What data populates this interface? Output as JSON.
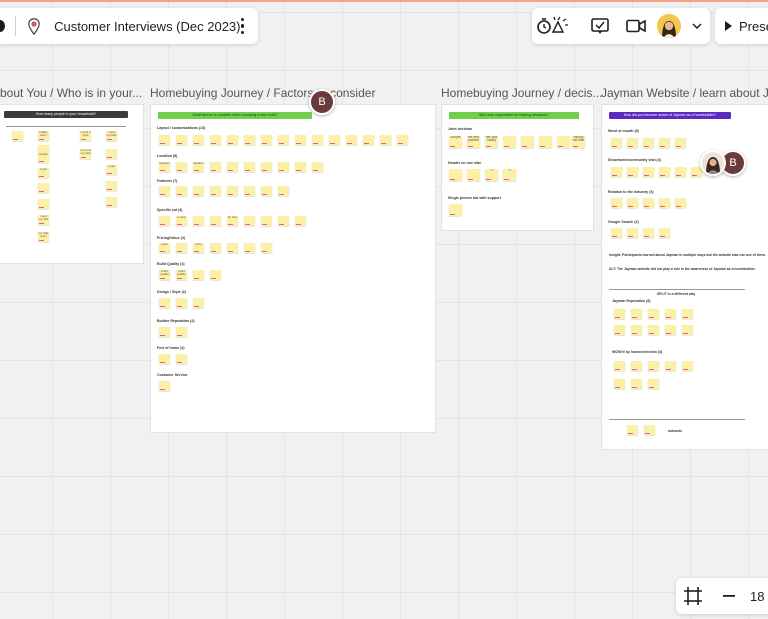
{
  "board": {
    "title": "Customer Interviews (Dec 2023)"
  },
  "toolbar": {
    "present_label": "Prese",
    "zoom_value": "18"
  },
  "users": {
    "marker_initial": "B"
  },
  "frames": [
    {
      "title": "bout You / Who is in your...",
      "banner": "How many people in your household?",
      "notes": [
        "hubby and i",
        "couple",
        "2 ppl",
        "i and my wife",
        "my wife and i",
        "i and my kids",
        "3 and 2 hppl",
        "me and my wife",
        "4 ppl"
      ]
    },
    {
      "title": "Homebuying Journey / Factors to consider",
      "banner": "What factors to consider when choosing a new build?",
      "categories": [
        "Layout / customizations (13)",
        "Location (8)",
        "Features (7)",
        "Specific cat (4)",
        "Pricing/Value (4)",
        "Build Quality (4)",
        "Design / Style (2)",
        "Builder Reputation (2)",
        "Feel of home (4)",
        "Customer Service"
      ],
      "notes": [
        "location",
        "location",
        "price",
        "price",
        "lot size",
        "a view",
        "build quality",
        "build quality"
      ]
    },
    {
      "title": "Homebuying Journey / decis...",
      "banner": "Who was responsible for making decisions?",
      "categories": [
        "Joint decision",
        "Header on one side",
        "Single person but with support"
      ],
      "notes": [
        "couple",
        "me and partner",
        "her and hubby",
        "mostly me wife",
        "??",
        "??"
      ]
    },
    {
      "title": "Jayman Website / learn about Ja...",
      "banner": "How did you become aware of Jayman as a homebuilder?",
      "categories": [
        "Word of mouth (5)",
        "Showhome/community visit (4)",
        "Relation to the industry (3)",
        "Google Search (2)",
        "Jayman Reputation (8)",
        "WOW'd by home/selection (3)"
      ],
      "insight_1": "Insight: Participants learned about Jayman in multiple ways but the website was not one of them.",
      "insight_2": "ALT: The Jayman website did not play a role in the awareness of Jayman as a homebuilder.",
      "split_label": "SPLIT in a different way",
      "outcasts_label": "outcasts"
    }
  ],
  "colors": {
    "banner_dark": "#3a3a3a",
    "banner_green": "#6fcf4c",
    "banner_purple": "#5b2bbf",
    "sticky": "#fcf0a6",
    "marker": "#6b3a3a"
  }
}
